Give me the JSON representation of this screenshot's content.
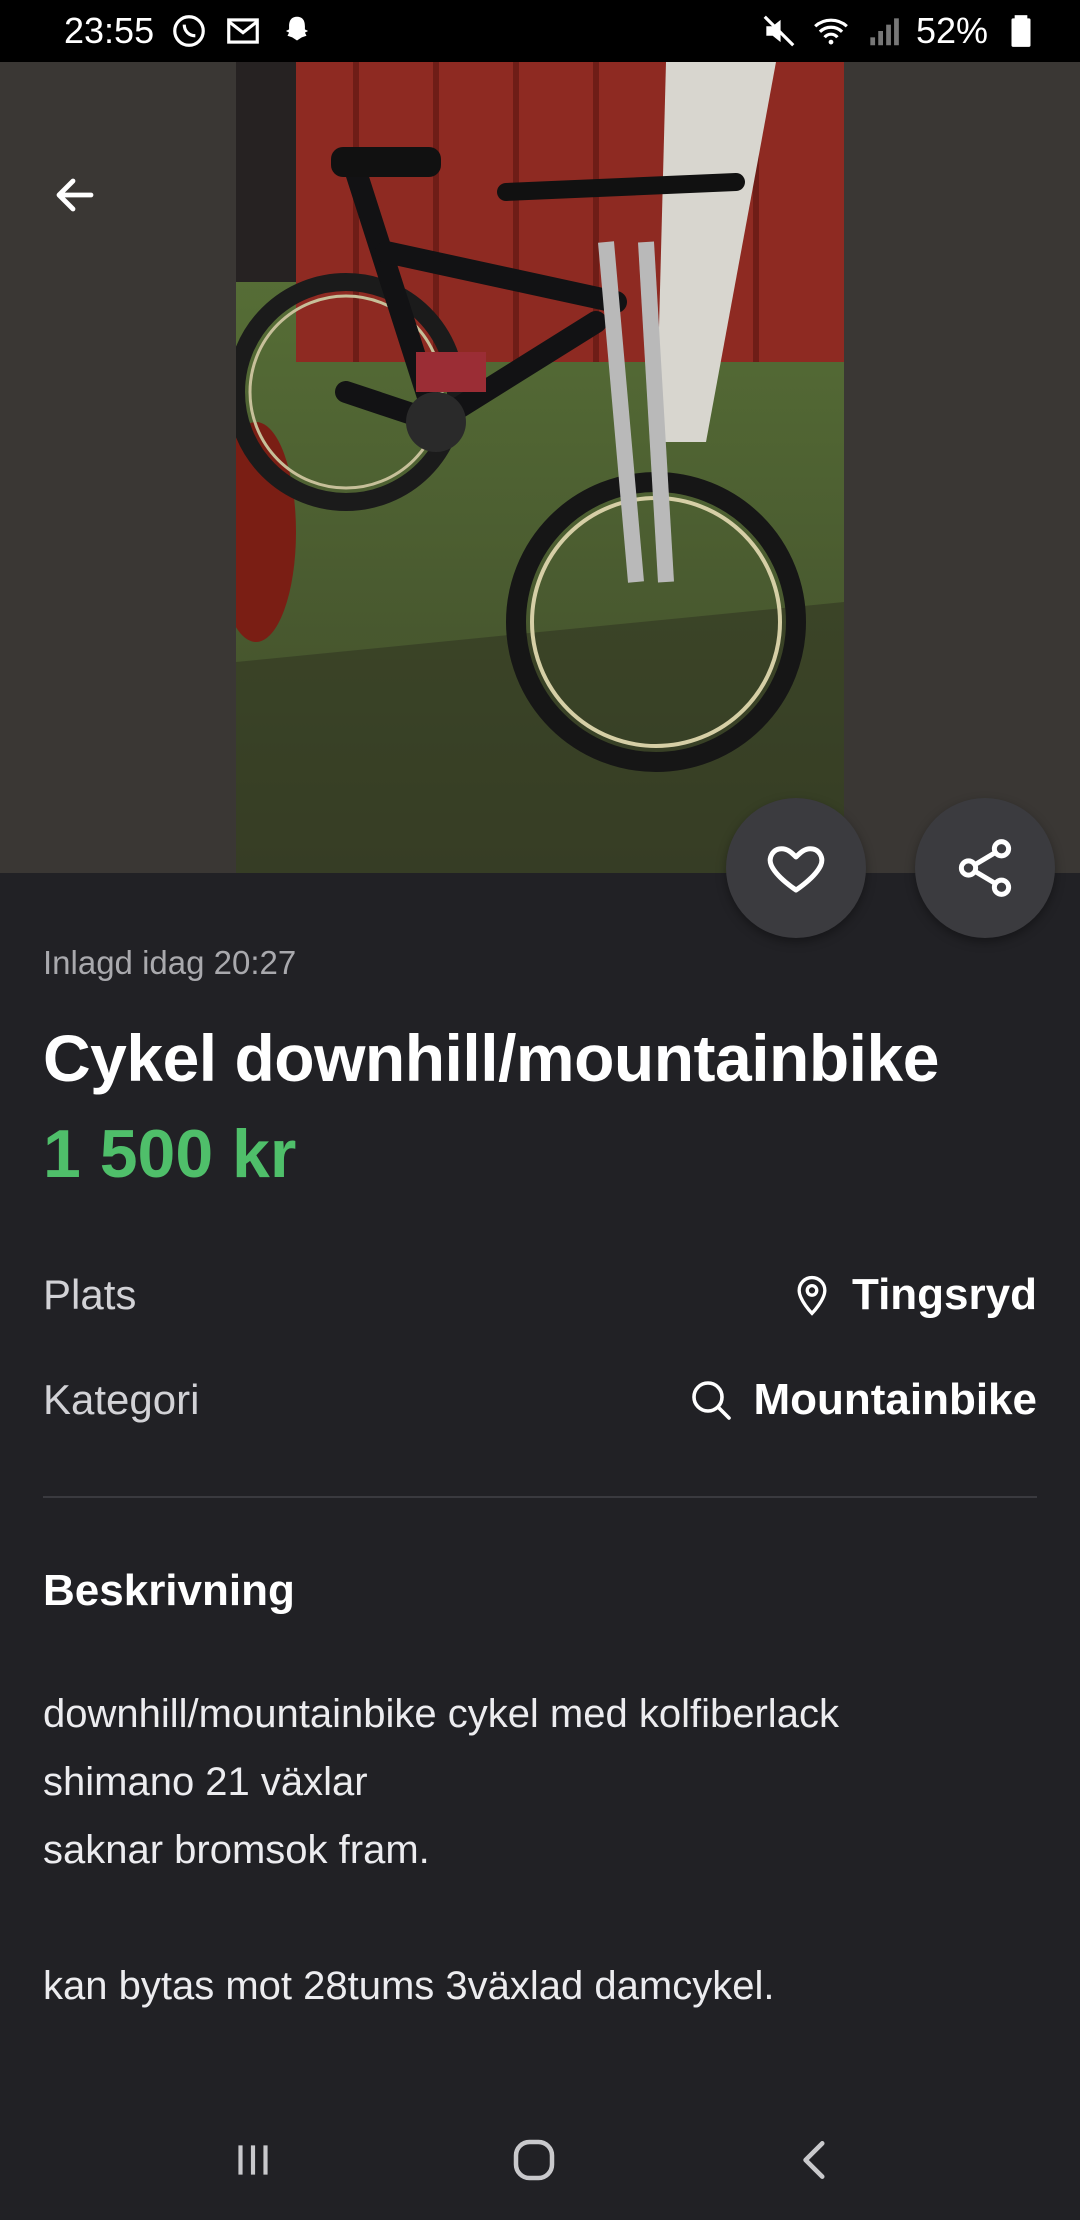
{
  "status_bar": {
    "time": "23:55",
    "battery": "52%",
    "left_icons": [
      "whatsapp-icon",
      "gmail-icon",
      "snapchat-icon"
    ],
    "right_icons": [
      "mute-icon",
      "wifi-icon",
      "signal-icon",
      "battery-icon"
    ]
  },
  "listing": {
    "posted": "Inlagd idag 20:27",
    "title": "Cykel downhill/mountainbike",
    "price": "1 500 kr",
    "details": [
      {
        "label": "Plats",
        "value": "Tingsryd",
        "icon": "location-pin-icon"
      },
      {
        "label": "Kategori",
        "value": "Mountainbike",
        "icon": "search-icon"
      }
    ],
    "description_heading": "Beskrivning",
    "description_lines": [
      "downhill/mountainbike cykel med kolfiberlack",
      "shimano 21 växlar",
      "saknar bromsok fram.",
      "",
      "kan bytas mot 28tums 3växlad damcykel."
    ]
  },
  "colors": {
    "background": "#212125",
    "price": "#4fbf6a",
    "button_bg": "#3b3b3f",
    "muted_text": "#a9a9ad"
  }
}
